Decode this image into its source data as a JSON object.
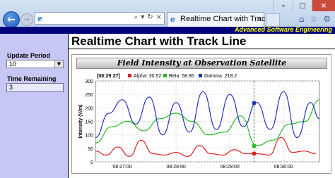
{
  "browser": {
    "tab_title": "Realtime Chart with Track ...",
    "tab_close": "×",
    "address_tools": [
      "⌕",
      "▾",
      "↻",
      "×"
    ],
    "window_controls": [
      "–",
      "□",
      "×"
    ],
    "toolbar_icons": [
      "⌂",
      "☆",
      "⚙"
    ]
  },
  "header": {
    "brand": "Advanced Software Engineering",
    "page_title": "Realtime Chart with Track Line"
  },
  "sidebar": {
    "update_period_label": "Update Period",
    "update_period_value": "10",
    "time_remaining_label": "Time Remaining",
    "time_remaining_value": "3"
  },
  "colors": {
    "alpha": "#dd2222",
    "beta": "#22bb22",
    "gamma": "#2233bb",
    "header_bg": "#00007a",
    "brand_text": "#ffff00",
    "sidebar_bg": "#c7c7f5"
  },
  "chart_data": {
    "type": "line",
    "title": "Field Intensity at Observation Satellite",
    "ylabel": "Intensity (V/m)",
    "ylim": [
      0,
      300
    ],
    "y_ticks": [
      "0",
      "50",
      "100",
      "150",
      "200",
      "250",
      "300"
    ],
    "x_ticks": [
      "08:27:00",
      "08:28:00",
      "08:29:00",
      "08:30:00"
    ],
    "track_time": "[08:29:27]",
    "legend": [
      {
        "key": "alpha",
        "text": "Alpha: 30.52"
      },
      {
        "key": "beta",
        "text": "Beta: 58.85"
      },
      {
        "key": "gamma",
        "text": "Gamma: 218.2"
      }
    ],
    "x_range": [
      "08:26:30",
      "08:30:40"
    ],
    "series": [
      {
        "name": "Alpha",
        "x": [
          "08:26:30",
          "08:26:42",
          "08:26:55",
          "08:27:08",
          "08:27:21",
          "08:27:34",
          "08:27:47",
          "08:28:00",
          "08:28:13",
          "08:28:26",
          "08:28:39",
          "08:28:52",
          "08:29:05",
          "08:29:18",
          "08:29:31",
          "08:29:44",
          "08:29:57",
          "08:30:10",
          "08:30:23",
          "08:30:36"
        ],
        "values": [
          40,
          25,
          55,
          20,
          80,
          30,
          25,
          35,
          20,
          60,
          30,
          25,
          45,
          30,
          30,
          25,
          90,
          35,
          40,
          30
        ]
      },
      {
        "name": "Beta",
        "x": [
          "08:26:30",
          "08:26:48",
          "08:27:06",
          "08:27:24",
          "08:27:42",
          "08:28:00",
          "08:28:18",
          "08:28:36",
          "08:28:54",
          "08:29:12",
          "08:29:30",
          "08:29:48",
          "08:30:06",
          "08:30:24",
          "08:30:40"
        ],
        "values": [
          70,
          130,
          150,
          115,
          160,
          180,
          150,
          100,
          110,
          170,
          60,
          80,
          140,
          150,
          230
        ]
      },
      {
        "name": "Gamma",
        "x": [
          "08:26:30",
          "08:26:45",
          "08:27:00",
          "08:27:15",
          "08:27:30",
          "08:27:45",
          "08:28:00",
          "08:28:15",
          "08:28:30",
          "08:28:45",
          "08:29:00",
          "08:29:15",
          "08:29:30",
          "08:29:45",
          "08:30:00",
          "08:30:15",
          "08:30:30",
          "08:30:40"
        ],
        "values": [
          90,
          180,
          230,
          140,
          240,
          100,
          220,
          110,
          260,
          120,
          250,
          130,
          220,
          120,
          260,
          90,
          220,
          160
        ]
      }
    ],
    "track_values": {
      "Alpha": 30.52,
      "Beta": 58.85,
      "Gamma": 218.2
    }
  }
}
